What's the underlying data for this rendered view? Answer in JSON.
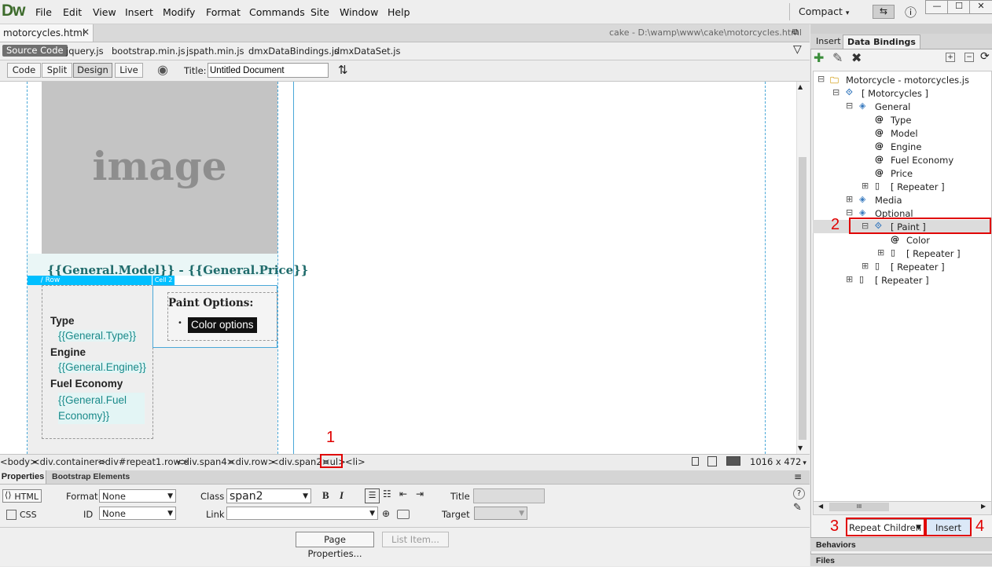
{
  "app": {
    "logo": "Dw",
    "workspace": "Compact",
    "workspace_arrow": "▾",
    "minimize": "—",
    "maximize": "☐",
    "close": "✕",
    "help": "ⓘ",
    "sync": "⇆"
  },
  "menu": [
    "File",
    "Edit",
    "View",
    "Insert",
    "Modify",
    "Format",
    "Commands",
    "Site",
    "Window",
    "Help"
  ],
  "document": {
    "tab": "motorcycles.html",
    "tab_close": "✕",
    "path": "cake - D:\\wamp\\www\\cake\\motorcycles.html",
    "restore": "⧉"
  },
  "related_files": {
    "source": "Source Code",
    "files": [
      "jquery.js",
      "bootstrap.min.js",
      "jspath.min.js",
      "dmxDataBindings.js",
      "dmxDataSet.js"
    ],
    "filter_icon": "▽"
  },
  "toolbar": {
    "code": "Code",
    "split": "Split",
    "design": "Design",
    "live": "Live",
    "title_label": "Title:",
    "title_value": "Untitled Document",
    "globe": "◉",
    "transfer": "⇅"
  },
  "design": {
    "image_text": "image",
    "heading": "{{General.Model}} - {{General.Price}}",
    "row_label": "/ Row",
    "cell_label": "Cell 2",
    "fields": [
      {
        "label": "Type",
        "value": "{{General.Type}}"
      },
      {
        "label": "Engine",
        "value": "{{General.Engine}}"
      },
      {
        "label": "Fuel Economy",
        "value": "{{General.Fuel Economy}}"
      }
    ],
    "paint_heading": "Paint Options:",
    "color_item": "Color options",
    "bullet": "•"
  },
  "status": {
    "tags": [
      "<body>",
      "<div.container>",
      "<div#repeat1.row>",
      "<div.span4>",
      "<div.row>",
      "<div.span2>",
      "<ul>",
      "<li>"
    ],
    "size": "1016 x 472",
    "size_arrow": "▾"
  },
  "properties": {
    "tab": "Properties",
    "tab2": "Bootstrap Elements",
    "html_btn": "HTML",
    "css_btn": "CSS",
    "format_label": "Format",
    "format_value": "None",
    "id_label": "ID",
    "id_value": "None",
    "class_label": "Class",
    "class_value": "span2",
    "link_label": "Link",
    "title_label": "Title",
    "target_label": "Target",
    "bold": "B",
    "italic": "I",
    "page_props": "Page Properties...",
    "list_item": "List Item...",
    "menu": "≡",
    "help": "?"
  },
  "panel": {
    "tab_insert": "Insert",
    "tab_bindings": "Data Bindings",
    "add": "✚",
    "edit": "✎",
    "delete": "✖",
    "tree": [
      {
        "label": "Motorcycle - motorcycles.js",
        "indent": 0,
        "icon": "folder",
        "toggle": "⊟"
      },
      {
        "label": "[ Motorcycles ]",
        "indent": 1,
        "icon": "repeat",
        "toggle": "⊟"
      },
      {
        "label": "General",
        "indent": 2,
        "icon": "diamond",
        "toggle": "⊟"
      },
      {
        "label": "Type",
        "indent": 3,
        "icon": "at",
        "toggle": ""
      },
      {
        "label": "Model",
        "indent": 3,
        "icon": "at",
        "toggle": ""
      },
      {
        "label": "Engine",
        "indent": 3,
        "icon": "at",
        "toggle": ""
      },
      {
        "label": "Fuel Economy",
        "indent": 3,
        "icon": "at",
        "toggle": ""
      },
      {
        "label": "Price",
        "indent": 3,
        "icon": "at",
        "toggle": ""
      },
      {
        "label": "[ Repeater ]",
        "indent": 3,
        "icon": "page",
        "toggle": "⊞"
      },
      {
        "label": "Media",
        "indent": 2,
        "icon": "diamond",
        "toggle": "⊞"
      },
      {
        "label": "Optional",
        "indent": 2,
        "icon": "diamond",
        "toggle": "⊟"
      },
      {
        "label": "[ Paint ]",
        "indent": 3,
        "icon": "repeat",
        "toggle": "⊟"
      },
      {
        "label": "Color",
        "indent": 4,
        "icon": "at",
        "toggle": ""
      },
      {
        "label": "[ Repeater ]",
        "indent": 4,
        "icon": "page",
        "toggle": "⊞"
      },
      {
        "label": "[ Repeater ]",
        "indent": 3,
        "icon": "page",
        "toggle": "⊞"
      },
      {
        "label": "[ Repeater ]",
        "indent": 2,
        "icon": "page",
        "toggle": "⊞"
      }
    ],
    "scroll_mid": "III",
    "repeat_select": "Repeat Children",
    "insert_btn": "Insert",
    "behaviors": "Behaviors",
    "files": "Files"
  },
  "annotations": [
    "1",
    "2",
    "3",
    "4"
  ],
  "colors": {
    "annotation": "#e00000",
    "binding_text": "#1a8a8a",
    "row_tag": "#00bfff"
  }
}
